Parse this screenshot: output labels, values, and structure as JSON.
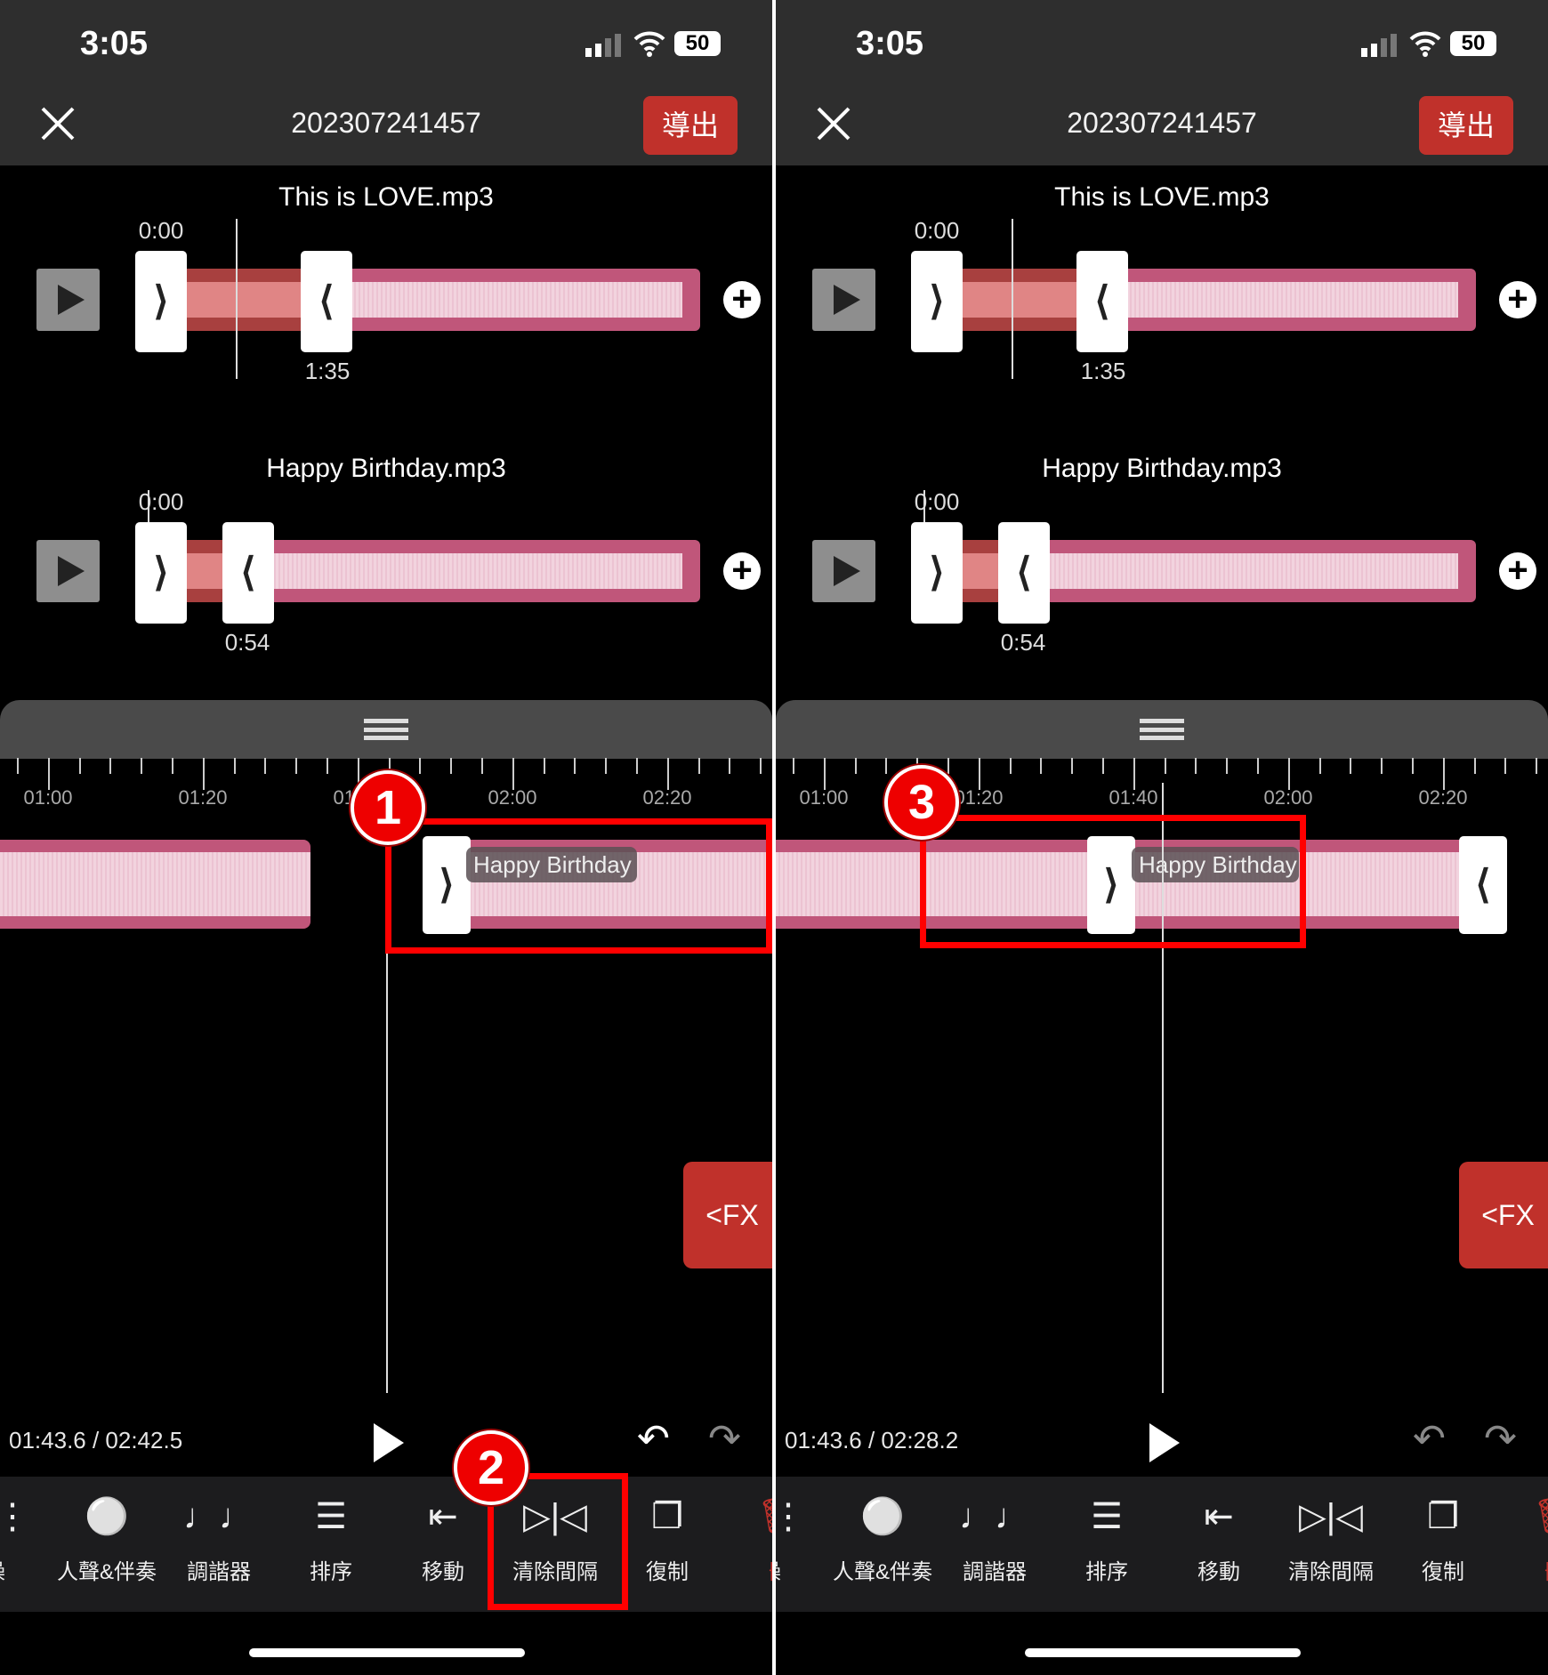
{
  "panels": [
    {
      "status_time": "3:05",
      "battery": "50",
      "project_title": "202307241457",
      "export_label": "導出",
      "tracks": [
        {
          "name": "This is LOVE.mp3",
          "start": "0:00",
          "end": "1:35"
        },
        {
          "name": "Happy Birthday.mp3",
          "start": "0:00",
          "end": "0:54"
        }
      ],
      "ruler_labels": [
        "01:00",
        "01:20",
        "01:40",
        "02:00",
        "02:20"
      ],
      "clip_label": "Happy Birthday",
      "badge": "1",
      "badge2": "2",
      "fx_label": "<FX",
      "playback_time": "01:43.6 / 02:42.5",
      "undo_enabled": true,
      "redo_enabled": false
    },
    {
      "status_time": "3:05",
      "battery": "50",
      "project_title": "202307241457",
      "export_label": "導出",
      "tracks": [
        {
          "name": "This is LOVE.mp3",
          "start": "0:00",
          "end": "1:35"
        },
        {
          "name": "Happy Birthday.mp3",
          "start": "0:00",
          "end": "0:54"
        }
      ],
      "ruler_labels": [
        "01:00",
        "01:20",
        "01:40",
        "02:00",
        "02:20"
      ],
      "clip_label": "Happy Birthday",
      "badge": "3",
      "fx_label": "<FX",
      "playback_time": "01:43.6 / 02:28.2",
      "undo_enabled": false,
      "redo_enabled": false
    }
  ],
  "toolbar": {
    "items": [
      {
        "label": "操",
        "icon": "sliders-icon"
      },
      {
        "label": "人聲&伴奏",
        "icon": "vocal-separate-icon"
      },
      {
        "label": "調諧器",
        "icon": "music-notes-icon"
      },
      {
        "label": "排序",
        "icon": "numbered-list-icon"
      },
      {
        "label": "移動",
        "icon": "move-left-icon"
      },
      {
        "label": "清除間隔",
        "icon": "remove-gap-icon"
      },
      {
        "label": "復制",
        "icon": "copy-icon"
      },
      {
        "label": "刪",
        "icon": "trash-icon"
      }
    ]
  },
  "colors": {
    "accent": "#c0312b",
    "clip": "#c0567a",
    "highlight": "#ff0000"
  }
}
